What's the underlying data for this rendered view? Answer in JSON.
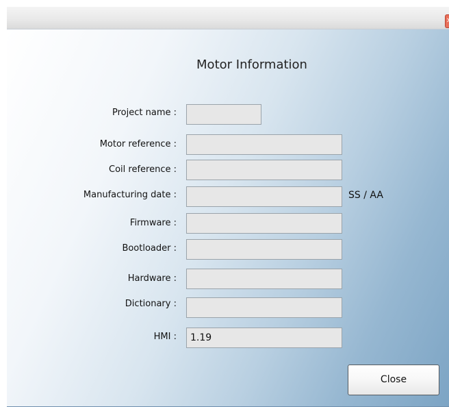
{
  "window": {
    "title": "",
    "close_glyph": "✕"
  },
  "dialog": {
    "title": "Motor Information",
    "date_format": "SS / AA",
    "close_label": "Close"
  },
  "fields": [
    {
      "label": "Project name :",
      "value": ""
    },
    {
      "label": "Motor reference :",
      "value": ""
    },
    {
      "label": "Coil reference :",
      "value": ""
    },
    {
      "label": "Manufacturing date :",
      "value": ""
    },
    {
      "label": "Firmware :",
      "value": ""
    },
    {
      "label": "Bootloader :",
      "value": ""
    },
    {
      "label": "Hardware :",
      "value": ""
    },
    {
      "label": "Dictionary :",
      "value": ""
    },
    {
      "label": "HMI :",
      "value": "1.19"
    }
  ],
  "colors": {
    "field_background": "#e7e7e7",
    "field_border": "#9aa3aa",
    "dialog_gradient_start": "#ffffff",
    "dialog_gradient_end": "#7ca4c4",
    "close_button_border": "#555b60"
  }
}
